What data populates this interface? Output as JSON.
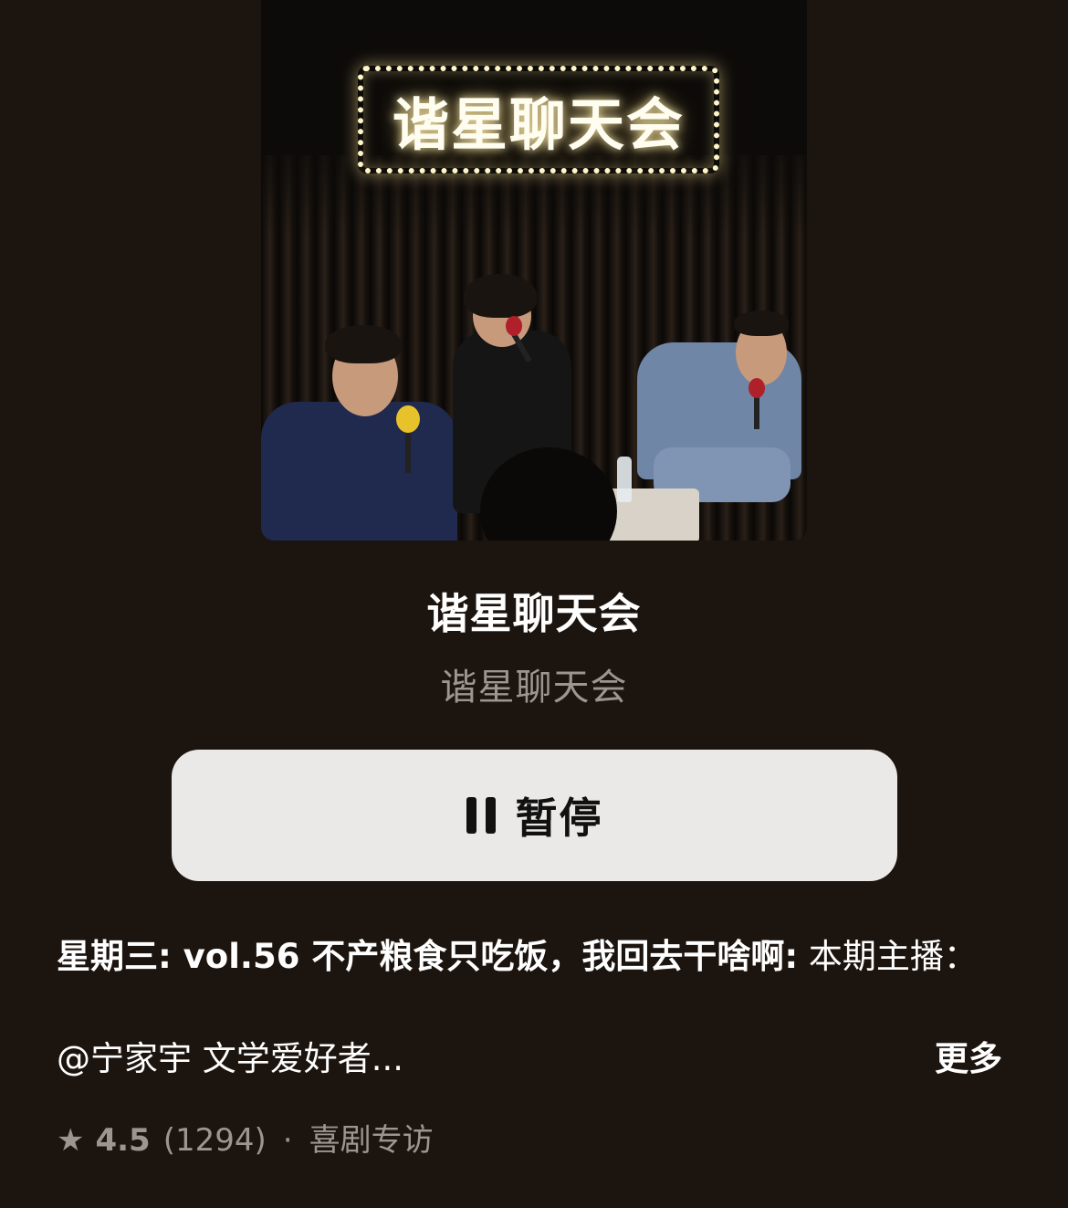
{
  "artwork": {
    "marquee_text": "谐星聊天会"
  },
  "podcast": {
    "title": "谐星聊天会",
    "author": "谐星聊天会"
  },
  "controls": {
    "pause_label": "暂停",
    "pause_icon": "pause-icon"
  },
  "episode": {
    "label": "星期三: vol.56 不产粮食只吃饭，我回去干啥啊:",
    "description_rest": " 本期主播：",
    "description_line3": "@宁家宇 文学爱好者...",
    "more_label": "更多"
  },
  "meta": {
    "star_icon": "star-icon",
    "rating": "4.5",
    "count": "(1294)",
    "separator": "·",
    "category": "喜剧专访"
  },
  "colors": {
    "background": "#1c140e",
    "button_bg": "#ebe9e7",
    "secondary_text": "#9d9690"
  }
}
